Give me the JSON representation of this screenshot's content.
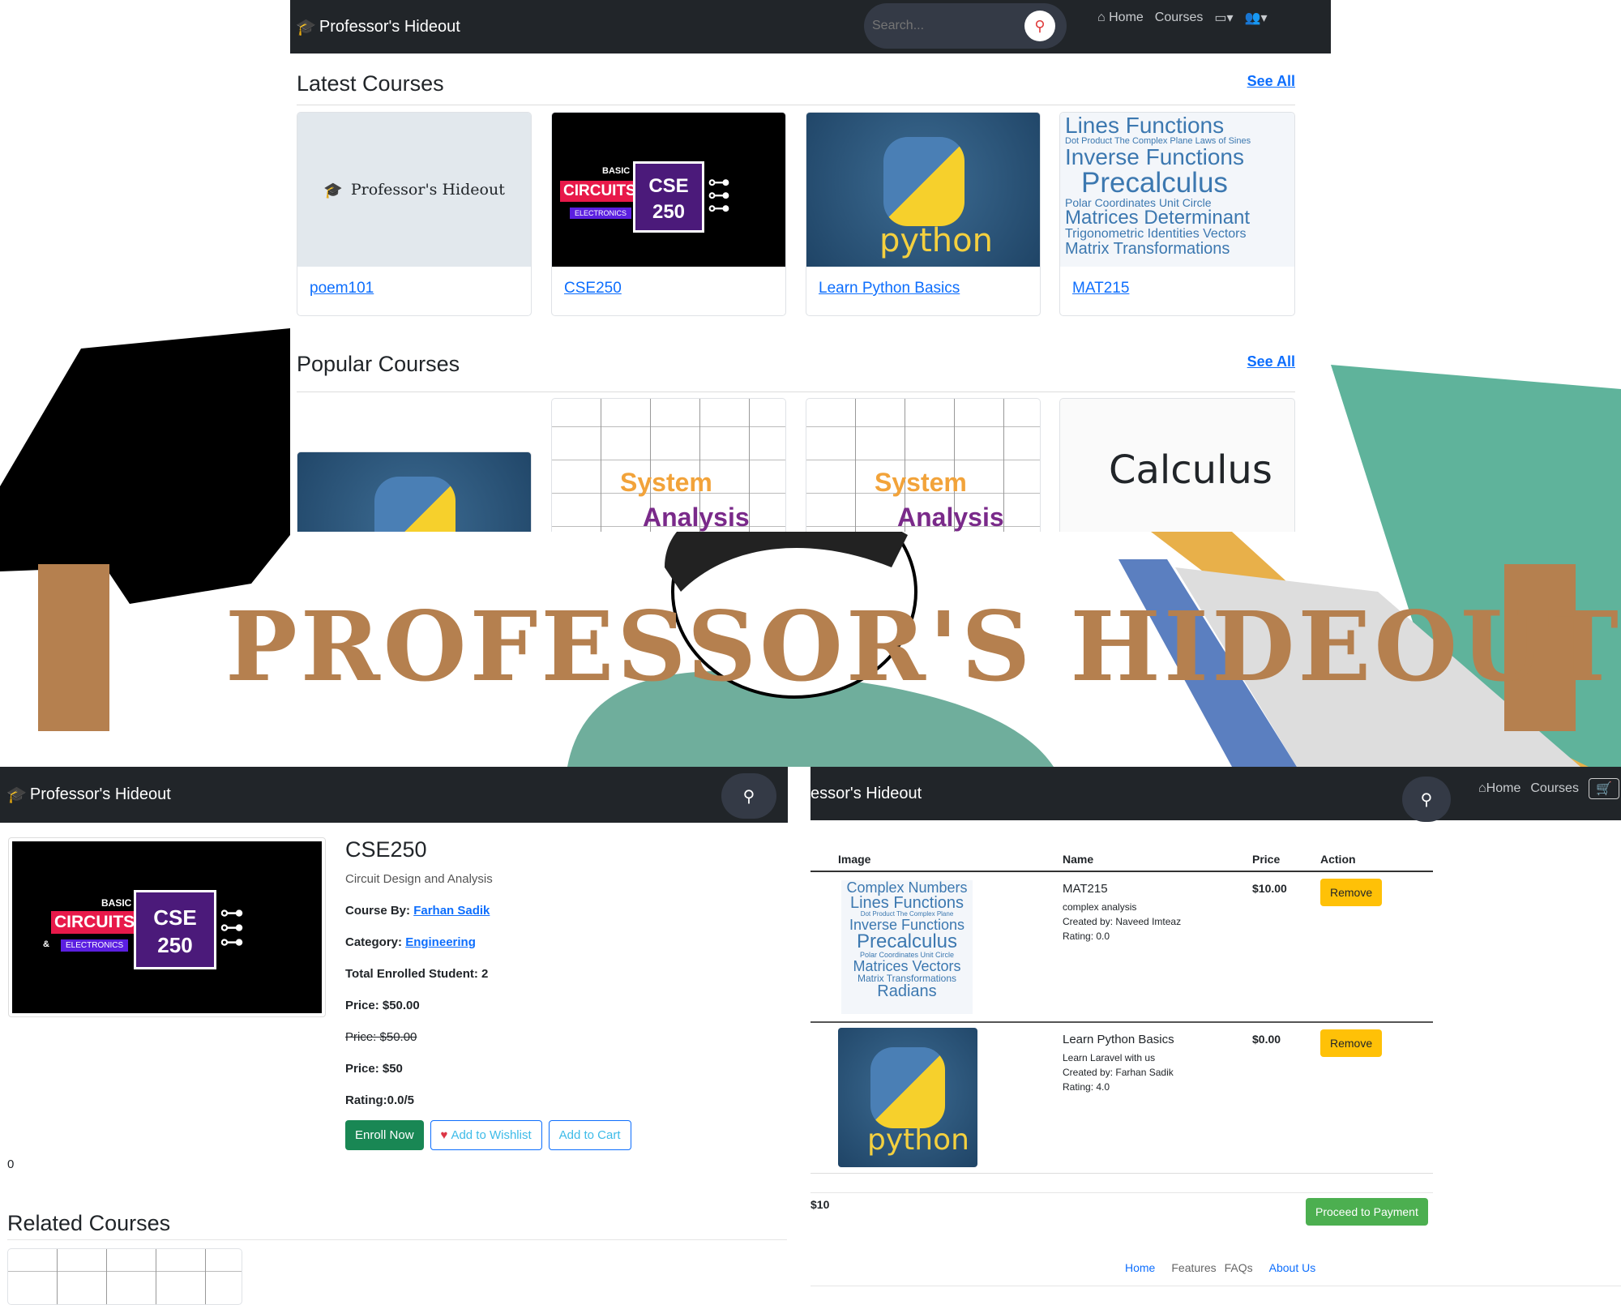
{
  "top": {
    "brand": "Professor's Hideout",
    "search_placeholder": "Search...",
    "nav": {
      "home": "Home",
      "courses": "Courses"
    },
    "latest": {
      "title": "Latest Courses",
      "see_all": "See All",
      "courses": [
        {
          "title": "poem101",
          "placeholder": "Professor's Hideout"
        },
        {
          "title": "CSE250"
        },
        {
          "title": "Learn Python Basics"
        },
        {
          "title": "MAT215"
        }
      ]
    },
    "popular": {
      "title": "Popular Courses",
      "see_all": "See All"
    }
  },
  "images": {
    "circuit": {
      "basic": "BASIC",
      "circuits": "CIRCUITS",
      "amp": "&",
      "electronics": "ELECTRONICS",
      "cse": "CSE",
      "num": "250"
    },
    "python": "python",
    "wordcloud": [
      "Lines Functions",
      "Dot Product The Complex Plane Laws of Sines",
      "Inverse Functions",
      "Precalculus",
      "Polar Coordinates Unit Circle",
      "Matrices Determinant",
      "Trigonometric Identities Vectors",
      "Matrix Transformations"
    ],
    "wordcloud2": [
      "Complex Numbers",
      "Lines Functions",
      "Dot Product The Complex Plane",
      "Inverse Functions",
      "Precalculus",
      "Polar Coordinates Unit Circle",
      "Matrices Vectors",
      "Matrix Transformations",
      "Radians"
    ],
    "system": "System",
    "analysis": "Analysis",
    "calculus": "Calculus"
  },
  "banner": {
    "title": "PROFESSOR'S HIDEOUT",
    "colors": {
      "brown": "#b5804f",
      "teal": "#5fb39b",
      "gold": "#e8b04a",
      "blue": "#5b7fc0"
    }
  },
  "detail": {
    "brand": "Professor's Hideout",
    "title": "CSE250",
    "subtitle": "Circuit Design and Analysis",
    "course_by_label": "Course By:",
    "course_by": "Farhan Sadik",
    "category_label": "Category:",
    "category": "Engineering",
    "enrolled": "Total Enrolled Student: 2",
    "price": "Price: $50.00",
    "old_price": "Price: $50.00",
    "price2": "Price: $50",
    "rating": "Rating:0.0/5",
    "enroll": "Enroll Now",
    "wishlist": "Add to Wishlist",
    "cart": "Add to Cart",
    "counter": "0",
    "related": "Related Courses"
  },
  "cart": {
    "brand": "essor's Hideout",
    "nav": {
      "home": "Home",
      "courses": "Courses"
    },
    "headers": [
      "Image",
      "Name",
      "Price",
      "Action"
    ],
    "rows": [
      {
        "name": "MAT215",
        "desc": "complex analysis",
        "creator": "Created by: Naveed Imteaz",
        "rating": "Rating: 0.0",
        "price": "$10.00",
        "action": "Remove"
      },
      {
        "name": "Learn Python Basics",
        "desc": "Learn Laravel with us",
        "creator": "Created by: Farhan Sadik",
        "rating": "Rating: 4.0",
        "price": "$0.00",
        "action": "Remove"
      }
    ],
    "total": "$10",
    "proceed": "Proceed to Payment",
    "footer": [
      "Home",
      "Features",
      "FAQs",
      "About Us"
    ]
  }
}
